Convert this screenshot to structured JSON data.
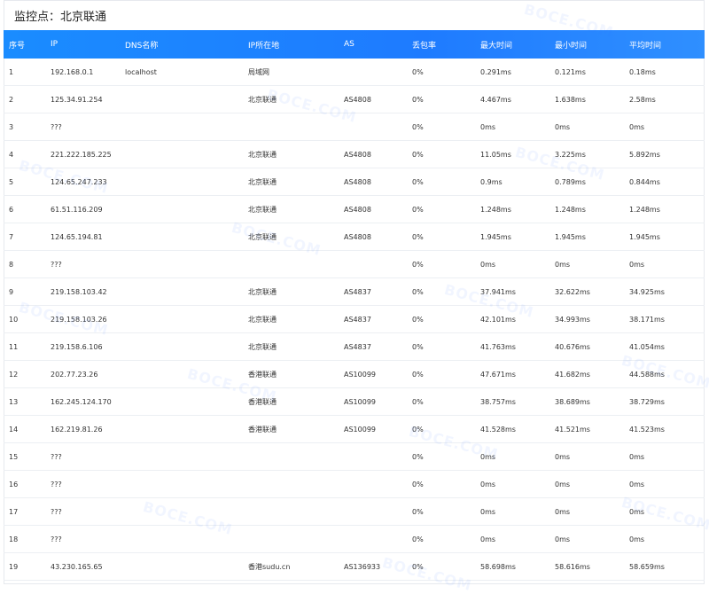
{
  "header": {
    "title": "监控点：北京联通"
  },
  "columns": [
    "序号",
    "IP",
    "DNS名称",
    "IP所在地",
    "AS",
    "丢包率",
    "最大时间",
    "最小时间",
    "平均时间"
  ],
  "rows": [
    [
      "1",
      "192.168.0.1",
      "localhost",
      "局域网",
      "",
      "0%",
      "0.291ms",
      "0.121ms",
      "0.18ms"
    ],
    [
      "2",
      "125.34.91.254",
      "",
      "北京联通",
      "AS4808",
      "0%",
      "4.467ms",
      "1.638ms",
      "2.58ms"
    ],
    [
      "3",
      "???",
      "",
      "",
      "",
      "0%",
      "0ms",
      "0ms",
      "0ms"
    ],
    [
      "4",
      "221.222.185.225",
      "",
      "北京联通",
      "AS4808",
      "0%",
      "11.05ms",
      "3.225ms",
      "5.892ms"
    ],
    [
      "5",
      "124.65.247.233",
      "",
      "北京联通",
      "AS4808",
      "0%",
      "0.9ms",
      "0.789ms",
      "0.844ms"
    ],
    [
      "6",
      "61.51.116.209",
      "",
      "北京联通",
      "AS4808",
      "0%",
      "1.248ms",
      "1.248ms",
      "1.248ms"
    ],
    [
      "7",
      "124.65.194.81",
      "",
      "北京联通",
      "AS4808",
      "0%",
      "1.945ms",
      "1.945ms",
      "1.945ms"
    ],
    [
      "8",
      "???",
      "",
      "",
      "",
      "0%",
      "0ms",
      "0ms",
      "0ms"
    ],
    [
      "9",
      "219.158.103.42",
      "",
      "北京联通",
      "AS4837",
      "0%",
      "37.941ms",
      "32.622ms",
      "34.925ms"
    ],
    [
      "10",
      "219.158.103.26",
      "",
      "北京联通",
      "AS4837",
      "0%",
      "42.101ms",
      "34.993ms",
      "38.171ms"
    ],
    [
      "11",
      "219.158.6.106",
      "",
      "北京联通",
      "AS4837",
      "0%",
      "41.763ms",
      "40.676ms",
      "41.054ms"
    ],
    [
      "12",
      "202.77.23.26",
      "",
      "香港联通",
      "AS10099",
      "0%",
      "47.671ms",
      "41.682ms",
      "44.588ms"
    ],
    [
      "13",
      "162.245.124.170",
      "",
      "香港联通",
      "AS10099",
      "0%",
      "38.757ms",
      "38.689ms",
      "38.729ms"
    ],
    [
      "14",
      "162.219.81.26",
      "",
      "香港联通",
      "AS10099",
      "0%",
      "41.528ms",
      "41.521ms",
      "41.523ms"
    ],
    [
      "15",
      "???",
      "",
      "",
      "",
      "0%",
      "0ms",
      "0ms",
      "0ms"
    ],
    [
      "16",
      "???",
      "",
      "",
      "",
      "0%",
      "0ms",
      "0ms",
      "0ms"
    ],
    [
      "17",
      "???",
      "",
      "",
      "",
      "0%",
      "0ms",
      "0ms",
      "0ms"
    ],
    [
      "18",
      "???",
      "",
      "",
      "",
      "0%",
      "0ms",
      "0ms",
      "0ms"
    ],
    [
      "19",
      "43.230.165.65",
      "",
      "香港sudu.cn",
      "AS136933",
      "0%",
      "58.698ms",
      "58.616ms",
      "58.659ms"
    ]
  ],
  "watermark": "BOCE.COM"
}
